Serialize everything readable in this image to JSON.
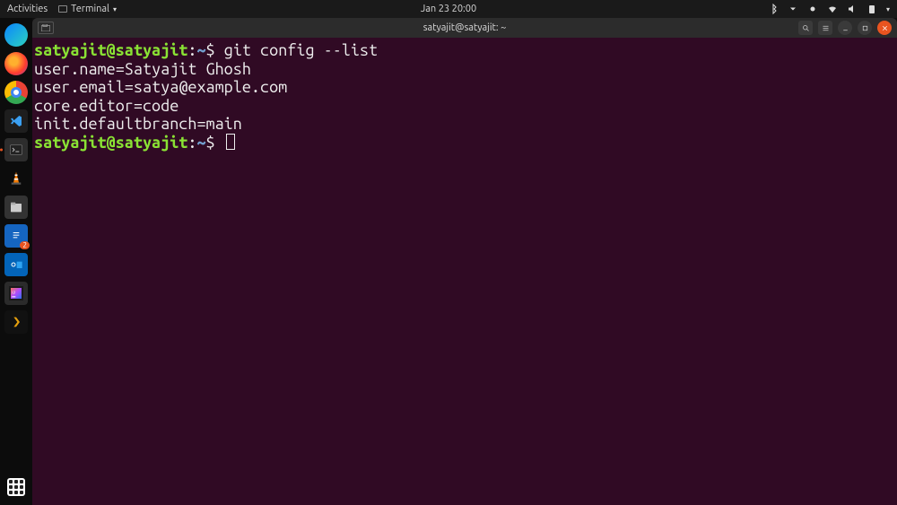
{
  "topbar": {
    "activities": "Activities",
    "app_name": "Terminal",
    "clock": "Jan 23  20:00"
  },
  "dock": {
    "items": [
      {
        "name": "edge",
        "label": "Microsoft Edge"
      },
      {
        "name": "firefox",
        "label": "Firefox"
      },
      {
        "name": "chrome",
        "label": "Google Chrome"
      },
      {
        "name": "vscode",
        "label": "Visual Studio Code"
      },
      {
        "name": "terminal",
        "label": "Terminal",
        "active": true
      },
      {
        "name": "vlc",
        "label": "VLC"
      },
      {
        "name": "files",
        "label": "Files"
      },
      {
        "name": "writer",
        "label": "LibreOffice Writer"
      },
      {
        "name": "outlook",
        "label": "Outlook"
      },
      {
        "name": "idea",
        "label": "IntelliJ IDEA"
      },
      {
        "name": "plex",
        "label": "Plex"
      }
    ]
  },
  "window": {
    "title": "satyajit@satyajit: ~"
  },
  "terminal": {
    "prompt": {
      "user_host": "satyajit@satyajit",
      "sep": ":",
      "path": "~",
      "symbol": "$"
    },
    "command": "git config --list",
    "output": [
      "user.name=Satyajit Ghosh",
      "user.email=satya@example.com",
      "core.editor=code",
      "init.defaultbranch=main"
    ]
  }
}
